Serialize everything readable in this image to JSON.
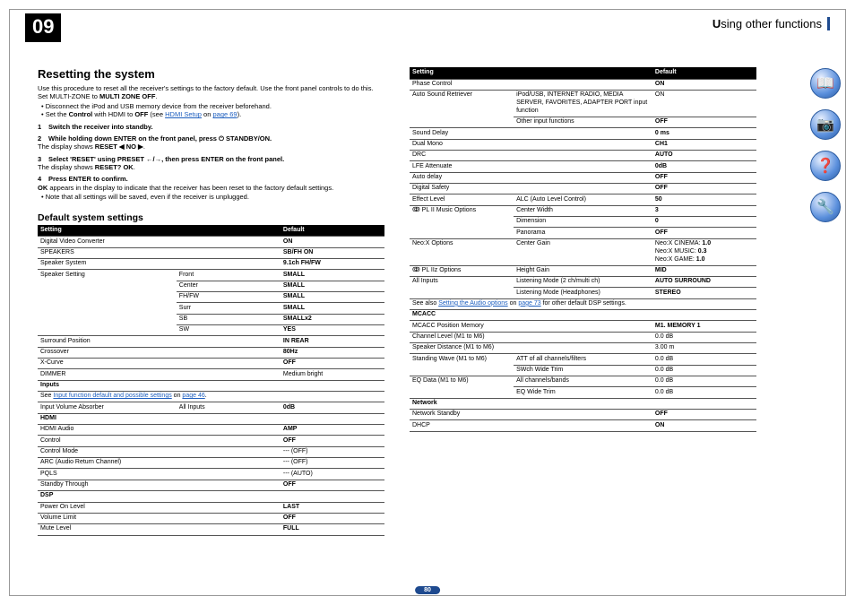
{
  "chapter": "09",
  "chapterTitle_pre": "U",
  "chapterTitle_rest": "sing other functions",
  "pageNum": "80",
  "h1": "Resetting the system",
  "intro1": "Use this procedure to reset all the receiver's settings to the factory default. Use the front panel controls to do this. Set MULTI-ZONE to ",
  "intro1b": "MULTI ZONE OFF",
  "intro1c": ".",
  "b1": "Disconnect the iPod and USB memory device from the receiver beforehand.",
  "b2a": "Set the ",
  "b2b": "Control",
  "b2c": " with HDMI to ",
  "b2d": "OFF",
  "b2e": " (see ",
  "b2link": "HDMI Setup",
  "b2f": " on ",
  "b2link2": "page 69",
  "b2g": ").",
  "s1": "Switch the receiver into standby.",
  "s2": "While holding down ENTER on the front panel, press ⏻ STANDBY/ON.",
  "s2note_a": "The display shows ",
  "s2note_b": "RESET ◀ NO ▶",
  "s2note_c": ".",
  "s3": "Select 'RESET' using PRESET ←/→, then press ENTER on the front panel.",
  "s3note_a": "The display shows ",
  "s3note_b": "RESET? OK",
  "s3note_c": ".",
  "s4": "Press ENTER to confirm.",
  "s4body_a": "OK",
  "s4body_b": " appears in the display to indicate that the receiver has been reset to the factory default settings.",
  "s4note": "Note that all settings will be saved, even if the receiver is unplugged.",
  "h2": "Default system settings",
  "th_setting": "Setting",
  "th_default": "Default",
  "t1": [
    {
      "c": [
        "Digital Video Converter",
        "",
        "ON"
      ],
      "b": [
        0,
        0,
        1
      ]
    },
    {
      "c": [
        "SPEAKERS",
        "",
        "SB/FH ON"
      ],
      "b": [
        0,
        0,
        1
      ]
    },
    {
      "c": [
        "Speaker System",
        "",
        "9.1ch FH/FW"
      ],
      "b": [
        0,
        0,
        1
      ]
    },
    {
      "c": [
        "Speaker Setting",
        "Front",
        "SMALL"
      ],
      "b": [
        0,
        0,
        1
      ],
      "rs": 6
    },
    {
      "c": [
        "",
        "Center",
        "SMALL"
      ],
      "b": [
        0,
        0,
        1
      ]
    },
    {
      "c": [
        "",
        "FH/FW",
        "SMALL"
      ],
      "b": [
        0,
        0,
        1
      ]
    },
    {
      "c": [
        "",
        "Surr",
        "SMALL"
      ],
      "b": [
        0,
        0,
        1
      ]
    },
    {
      "c": [
        "",
        "SB",
        "SMALLx2"
      ],
      "b": [
        0,
        0,
        1
      ]
    },
    {
      "c": [
        "",
        "SW",
        "YES"
      ],
      "b": [
        0,
        0,
        1
      ]
    },
    {
      "c": [
        "Surround Position",
        "",
        "IN REAR"
      ],
      "b": [
        0,
        0,
        1
      ]
    },
    {
      "c": [
        "Crossover",
        "",
        "80Hz"
      ],
      "b": [
        0,
        0,
        1
      ]
    },
    {
      "c": [
        "X-Curve",
        "",
        "OFF"
      ],
      "b": [
        0,
        0,
        1
      ]
    },
    {
      "c": [
        "DIMMER",
        "",
        "Medium bright"
      ],
      "b": [
        0,
        0,
        0
      ]
    }
  ],
  "t1_inputs": "Inputs",
  "t1_inputs_note_a": "See ",
  "t1_inputs_link": "Input function default and possible settings",
  "t1_inputs_note_b": " on ",
  "t1_inputs_link2": "page 46",
  "t1_inputs_note_c": ".",
  "t1b": [
    {
      "c": [
        "Input Volume Absorber",
        "All Inputs",
        "0dB"
      ],
      "b": [
        0,
        0,
        1
      ]
    }
  ],
  "t1_hdmi": "HDMI",
  "t1c": [
    {
      "c": [
        "HDMI Audio",
        "",
        "AMP"
      ],
      "b": [
        0,
        0,
        1
      ]
    },
    {
      "c": [
        "Control",
        "",
        "OFF"
      ],
      "b": [
        0,
        0,
        1
      ]
    },
    {
      "c": [
        "Control Mode",
        "",
        "--- (OFF)"
      ],
      "b": [
        0,
        0,
        0
      ]
    },
    {
      "c": [
        "ARC (Audio Return Channel)",
        "",
        "--- (OFF)"
      ],
      "b": [
        0,
        0,
        0
      ]
    },
    {
      "c": [
        "PQLS",
        "",
        "--- (AUTO)"
      ],
      "b": [
        0,
        0,
        0
      ]
    },
    {
      "c": [
        "Standby Through",
        "",
        "OFF"
      ],
      "b": [
        0,
        0,
        1
      ]
    }
  ],
  "t1_dsp": "DSP",
  "t1d": [
    {
      "c": [
        "Power On Level",
        "",
        "LAST"
      ],
      "b": [
        0,
        0,
        1
      ]
    },
    {
      "c": [
        "Volume Limit",
        "",
        "OFF"
      ],
      "b": [
        0,
        0,
        1
      ]
    },
    {
      "c": [
        "Mute Level",
        "",
        "FULL"
      ],
      "b": [
        0,
        0,
        1
      ]
    }
  ],
  "t2": [
    {
      "c": [
        "Phase Control",
        "",
        "ON"
      ],
      "b": [
        0,
        0,
        1
      ]
    },
    {
      "c": [
        "Auto Sound Retriever",
        "iPod/USB, INTERNET RADIO, MEDIA SERVER, FAVORITES, ADAPTER PORT input function",
        "ON"
      ],
      "b": [
        0,
        0,
        0
      ],
      "rs": 2
    },
    {
      "c": [
        "",
        "Other input functions",
        "OFF"
      ],
      "b": [
        0,
        0,
        1
      ]
    },
    {
      "c": [
        "Sound Delay",
        "",
        "0 ms"
      ],
      "b": [
        0,
        0,
        1
      ]
    },
    {
      "c": [
        "Dual Mono",
        "",
        "CH1"
      ],
      "b": [
        0,
        0,
        1
      ]
    },
    {
      "c": [
        "DRC",
        "",
        "AUTO"
      ],
      "b": [
        0,
        0,
        1
      ]
    },
    {
      "c": [
        "LFE Attenuate",
        "",
        "0dB"
      ],
      "b": [
        0,
        0,
        1
      ]
    },
    {
      "c": [
        "Auto delay",
        "",
        "OFF"
      ],
      "b": [
        0,
        0,
        1
      ]
    },
    {
      "c": [
        "Digital Safety",
        "",
        "OFF"
      ],
      "b": [
        0,
        0,
        1
      ]
    },
    {
      "c": [
        "Effect Level",
        "ALC (Auto Level Control)",
        "50"
      ],
      "b": [
        0,
        0,
        1
      ]
    },
    {
      "c": [
        "ↂ PL II Music Options",
        "Center Width",
        "3"
      ],
      "b": [
        0,
        0,
        1
      ],
      "rs": 3
    },
    {
      "c": [
        "",
        "Dimension",
        "0"
      ],
      "b": [
        0,
        0,
        1
      ]
    },
    {
      "c": [
        "",
        "Panorama",
        "OFF"
      ],
      "b": [
        0,
        0,
        1
      ]
    },
    {
      "c": [
        "Neo:X Options",
        "Center Gain",
        "Neo:X CINEMA: 1.0\nNeo:X MUSIC: 0.3\nNeo:X GAME: 1.0"
      ],
      "b": [
        0,
        0,
        0
      ]
    },
    {
      "c": [
        "ↂ PL IIz Options",
        "Height Gain",
        "MID"
      ],
      "b": [
        0,
        0,
        1
      ]
    },
    {
      "c": [
        "All Inputs",
        "Listening Mode (2 ch/multi ch)",
        "AUTO SURROUND"
      ],
      "b": [
        0,
        0,
        1
      ],
      "rs": 2
    },
    {
      "c": [
        "",
        "Listening Mode (Headphones)",
        "STEREO"
      ],
      "b": [
        0,
        0,
        1
      ]
    }
  ],
  "t2_note_a": "See also ",
  "t2_note_link": "Setting the Audio options",
  "t2_note_b": " on ",
  "t2_note_link2": "page 73",
  "t2_note_c": " for other default DSP settings.",
  "t2_mcacc": "MCACC",
  "t2b": [
    {
      "c": [
        "MCACC Position Memory",
        "",
        "M1. MEMORY 1"
      ],
      "b": [
        0,
        0,
        1
      ]
    },
    {
      "c": [
        "Channel Level (M1 to M6)",
        "",
        "0.0 dB"
      ],
      "b": [
        0,
        0,
        0
      ]
    },
    {
      "c": [
        "Speaker Distance (M1 to M6)",
        "",
        "3.00 m"
      ],
      "b": [
        0,
        0,
        0
      ]
    },
    {
      "c": [
        "Standing Wave (M1 to M6)",
        "ATT of all channels/filters",
        "0.0 dB"
      ],
      "b": [
        0,
        0,
        0
      ],
      "rs": 2
    },
    {
      "c": [
        "",
        "SWch Wide Trim",
        "0.0 dB"
      ],
      "b": [
        0,
        0,
        0
      ]
    },
    {
      "c": [
        "EQ Data (M1 to M6)",
        "All channels/bands",
        "0.0 dB"
      ],
      "b": [
        0,
        0,
        0
      ],
      "rs": 2
    },
    {
      "c": [
        "",
        "EQ Wide Trim",
        "0.0 dB"
      ],
      "b": [
        0,
        0,
        0
      ]
    }
  ],
  "t2_net": "Network",
  "t2c": [
    {
      "c": [
        "Network Standby",
        "",
        "OFF"
      ],
      "b": [
        0,
        0,
        1
      ]
    },
    {
      "c": [
        "DHCP",
        "",
        "ON"
      ],
      "b": [
        0,
        0,
        1
      ]
    }
  ],
  "icons": [
    "📖",
    "📷",
    "❓",
    "🔧"
  ]
}
